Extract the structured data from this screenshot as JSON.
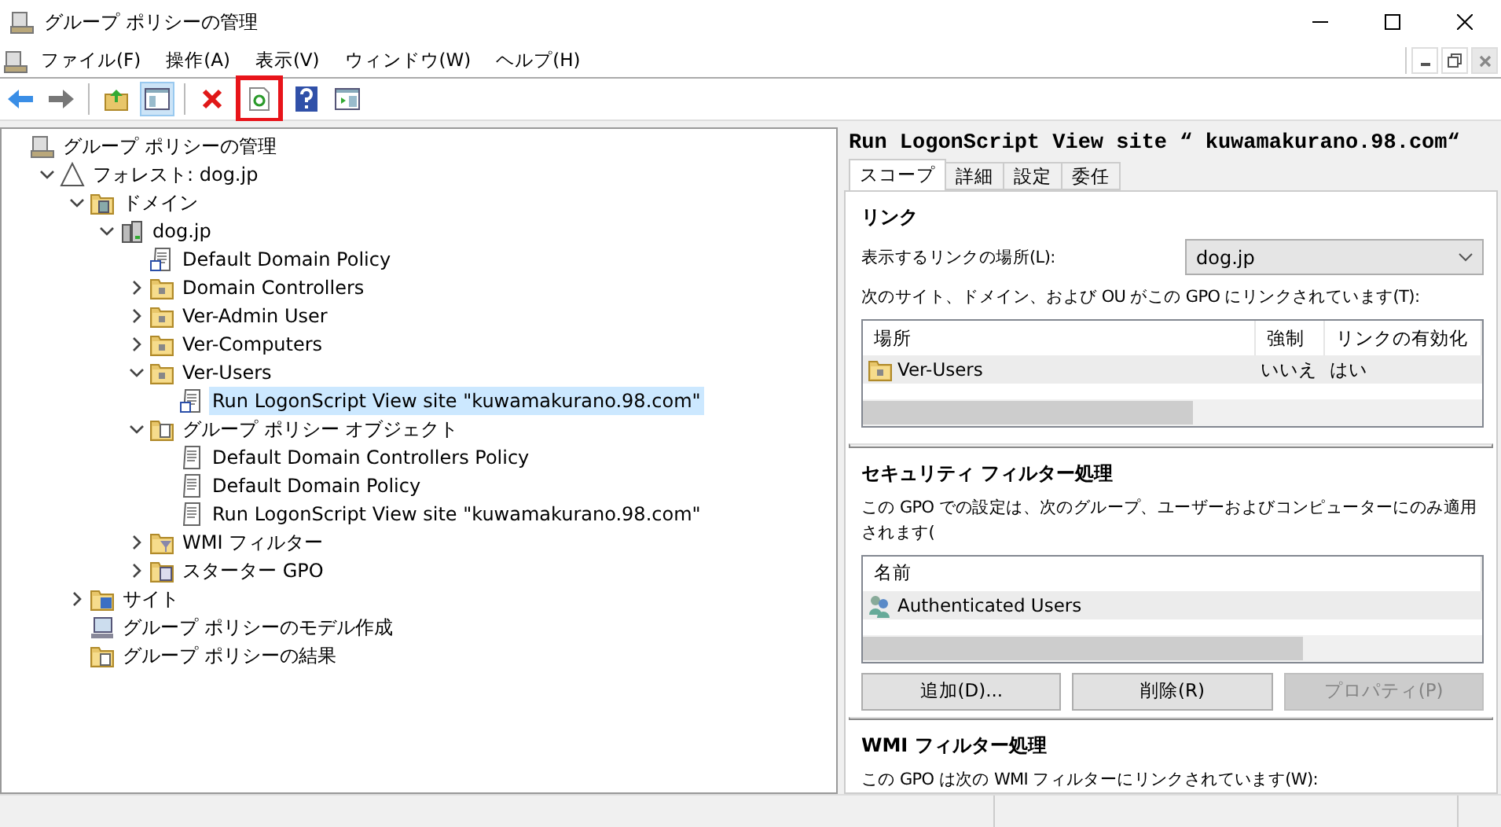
{
  "window": {
    "title": "グループ ポリシーの管理"
  },
  "menu": [
    "ファイル(F)",
    "操作(A)",
    "表示(V)",
    "ウィンドウ(W)",
    "ヘルプ(H)"
  ],
  "toolbar": [
    {
      "kind": "back",
      "selected": false,
      "highlighted": false
    },
    {
      "kind": "forward",
      "selected": false,
      "highlighted": false
    },
    {
      "kind": "sep"
    },
    {
      "kind": "up",
      "selected": false,
      "highlighted": false
    },
    {
      "kind": "tree",
      "selected": true,
      "highlighted": false
    },
    {
      "kind": "sep"
    },
    {
      "kind": "delete",
      "selected": false,
      "highlighted": false
    },
    {
      "kind": "refresh",
      "selected": false,
      "highlighted": true
    },
    {
      "kind": "help",
      "selected": false,
      "highlighted": false
    },
    {
      "kind": "pane",
      "selected": false,
      "highlighted": false
    }
  ],
  "tree": [
    {
      "label": "グループ ポリシーの管理",
      "kind": "console",
      "selected": false,
      "children": [
        {
          "label": "フォレスト: dog.jp",
          "kind": "forest",
          "expanded": true,
          "selected": false,
          "children": [
            {
              "label": "ドメイン",
              "kind": "domains",
              "expanded": true,
              "selected": false,
              "children": [
                {
                  "label": "dog.jp",
                  "kind": "domain",
                  "expanded": true,
                  "selected": false,
                  "children": [
                    {
                      "label": "Default Domain Policy",
                      "kind": "link",
                      "selected": false
                    },
                    {
                      "label": "Domain Controllers",
                      "kind": "ou",
                      "expanded": false,
                      "selected": false
                    },
                    {
                      "label": "Ver-Admin User",
                      "kind": "ou",
                      "expanded": false,
                      "selected": false
                    },
                    {
                      "label": "Ver-Computers",
                      "kind": "ou",
                      "expanded": false,
                      "selected": false
                    },
                    {
                      "label": "Ver-Users",
                      "kind": "ou",
                      "expanded": true,
                      "selected": false,
                      "children": [
                        {
                          "label": "Run LogonScript View site \"kuwamakurano.98.com\"",
                          "kind": "link",
                          "selected": true
                        }
                      ]
                    },
                    {
                      "label": "グループ ポリシー オブジェクト",
                      "kind": "gpofolder",
                      "expanded": true,
                      "selected": false,
                      "children": [
                        {
                          "label": "Default Domain Controllers Policy",
                          "kind": "gpo",
                          "selected": false
                        },
                        {
                          "label": "Default Domain Policy",
                          "kind": "gpo",
                          "selected": false
                        },
                        {
                          "label": "Run LogonScript View site \"kuwamakurano.98.com\"",
                          "kind": "gpo",
                          "selected": false
                        }
                      ]
                    },
                    {
                      "label": "WMI フィルター",
                      "kind": "wmi",
                      "expanded": false,
                      "selected": false
                    },
                    {
                      "label": "スターター GPO",
                      "kind": "starter",
                      "expanded": false,
                      "selected": false
                    }
                  ]
                }
              ]
            },
            {
              "label": "サイト",
              "kind": "sites",
              "expanded": false,
              "selected": false
            },
            {
              "label": "グループ ポリシーのモデル作成",
              "kind": "modeling",
              "selected": false
            },
            {
              "label": "グループ ポリシーの結果",
              "kind": "results",
              "selected": false
            }
          ]
        }
      ]
    }
  ],
  "details": {
    "title": "Run LogonScript View site “ kuwamakurano.98.com“",
    "tabs": [
      {
        "label": "スコープ",
        "selected": true
      },
      {
        "label": "詳細",
        "selected": false
      },
      {
        "label": "設定",
        "selected": false
      },
      {
        "label": "委任",
        "selected": false
      }
    ],
    "links": {
      "heading": "リンク",
      "location_label": "表示するリンクの場所(L):",
      "location_value": "dog.jp",
      "description": "次のサイト、ドメイン、および OU がこの GPO にリンクされています(T):",
      "columns": [
        "場所",
        "強制",
        "リンクの有効化"
      ],
      "rows": [
        {
          "cells": [
            "Ver-Users",
            "いいえ",
            "はい"
          ],
          "selected": true
        }
      ]
    },
    "security": {
      "heading": "セキュリティ フィルター処理",
      "description": "この GPO での設定は、次のグループ、ユーザーおよびコンピューターにのみ適用されます(",
      "columns": [
        "名前"
      ],
      "rows": [
        {
          "cells": [
            "Authenticated Users"
          ],
          "selected": true
        }
      ],
      "buttons": [
        {
          "label": "追加(D)...",
          "disabled": false
        },
        {
          "label": "削除(R)",
          "disabled": false
        },
        {
          "label": "プロパティ(P)",
          "disabled": true
        }
      ]
    },
    "wmi": {
      "heading": "WMI フィルター処理",
      "description": "この GPO は次の WMI フィルターにリンクされています(W):"
    }
  }
}
